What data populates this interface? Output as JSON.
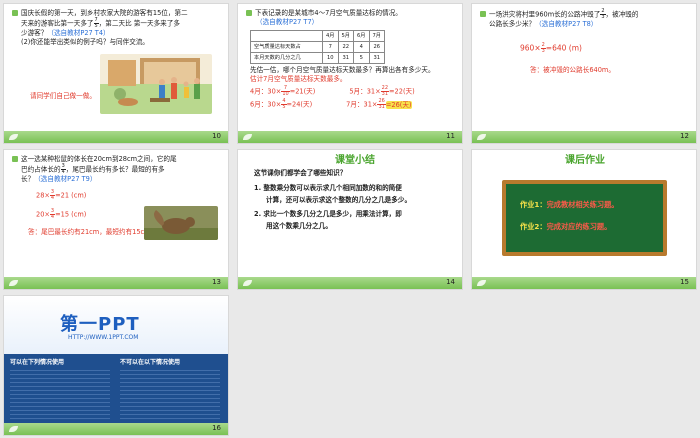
{
  "slides": {
    "s10": {
      "num": "10",
      "line1": "国庆长假的第一天，到乡村农家大院的游客有15位，第二",
      "line2": "天来的游客比第一天多了",
      "line2b": "，第二天比  第一天多来了多",
      "frac": {
        "n": "7",
        "d": "5"
      },
      "line3": "少游客？",
      "ref": "（选自教材P27 T4）",
      "q2": "(2)你还能举出类似的例子吗？与同伴交流。",
      "hint": "请同学们自己做一做。"
    },
    "s11": {
      "num": "11",
      "q": "下表记录的是某城市4～7月空气质量达标的情况。",
      "ref": "（选自教材P27 T7）",
      "table": {
        "headers": [
          "",
          "4月",
          "5月",
          "6月",
          "7月"
        ],
        "rows": [
          [
            "空气质量达标天数占本月天数的几分之几",
            "7/10",
            "22/31",
            "4/5",
            "26/31"
          ]
        ],
        "rows_display": [
          [
            "空气质量达标天数占",
            "7",
            "22",
            "4",
            "26"
          ],
          [
            "本月天数的几分之几",
            "10",
            "31",
            "5",
            "31"
          ]
        ]
      },
      "ask": "先估一估，哪个月空气质量达标天数最多？再算出各有多少天。",
      "estimate": "估计7月空气质量达标天数最多。",
      "calc1": "4月：30×",
      "calc1f": {
        "n": "7",
        "d": "10"
      },
      "calc1r": "=21(天)",
      "calc2": "5月：31×",
      "calc2f": {
        "n": "22",
        "d": "31"
      },
      "calc2r": "=22(天)",
      "calc3": "6月：30×",
      "calc3f": {
        "n": "4",
        "d": "5"
      },
      "calc3r": "=24(天)",
      "calc4": "7月：31×",
      "calc4f": {
        "n": "26",
        "d": "31"
      },
      "calc4r": "=26(天)"
    },
    "s12": {
      "num": "12",
      "q1": "一场洪灾将村里960m长的公路冲毁了",
      "frac": {
        "n": "2",
        "d": "3"
      },
      "q1b": "，被冲毁的",
      "q2": "公路长多少米？",
      "ref": "（选自教材P27 T8）",
      "calc": "960×",
      "calc_r": "=640 (m)",
      "answer": "答：被冲毁的公路长640m。"
    },
    "s13": {
      "num": "13",
      "q1": "这一选某种松鼠的体长在20cm到28cm之间，它的尾",
      "q2a": "巴约占体长的",
      "frac": {
        "n": "3",
        "d": "4"
      },
      "q2b": "，尾巴最长约有多长？最短的有多",
      "q3": "长？",
      "ref": "（选自教材P27 T9）",
      "calc1": "28×",
      "calc1r": "=21 (cm)",
      "calc2": "20×",
      "calc2r": "=15 (cm)",
      "answer": "答：尾巴最长约有21cm，最短约有15cm。"
    },
    "s14": {
      "num": "14",
      "title": "课堂小结",
      "q": "这节课你们都学会了哪些知识？",
      "p1a": "1.  整数乘分数可以表示求几个相同加数的和的简便",
      "p1b": "计算，还可以表示求这个整数的几分之几是多少。",
      "p2a": "2.  求比一个数多几分之几是多少，用乘法计算，即",
      "p2b": "用这个数乘几分之几。"
    },
    "s15": {
      "num": "15",
      "title": "课后作业",
      "hw1_label": "作业1：",
      "hw1": "完成教材相关练习题。",
      "hw2_label": "作业2：",
      "hw2": "完成对应的练习题。"
    },
    "s16": {
      "num": "16",
      "logo": "第一PPT",
      "url": "HTTP://WWW.1PPT.COM",
      "can_title": "可以在下列情况使用",
      "cannot_title": "不可以在以下情况使用"
    }
  },
  "colors": {
    "accent_green": "#79c154",
    "blue_ref": "#2a6fd6",
    "red_answer": "#e03a2c",
    "board": "#1d6b33"
  }
}
